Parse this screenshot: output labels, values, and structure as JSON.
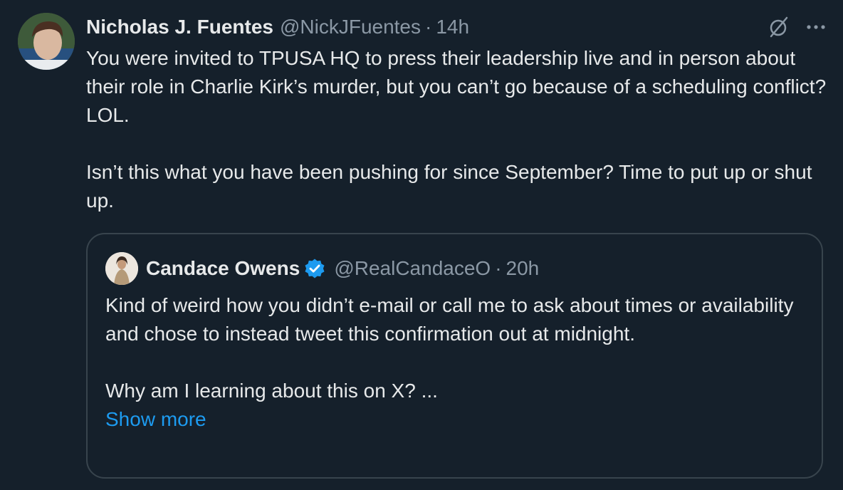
{
  "tweet": {
    "author": {
      "display_name": "Nicholas J. Fuentes",
      "handle": "@NickJFuentes",
      "separator": "·",
      "time": "14h",
      "avatar_icon": "profile-photo"
    },
    "paragraphs": [
      "You were invited to TPUSA HQ to press their leadership live and in person about their role in Charlie Kirk’s murder, but you can’t go because of a scheduling conflict? LOL.",
      "Isn’t this what you have been pushing for since September? Time to put up or shut up."
    ],
    "actions": {
      "grok_icon": "grok-icon",
      "more_icon": "more-options-icon"
    }
  },
  "quote": {
    "author": {
      "display_name": "Candace Owens",
      "verified": true,
      "handle": "@RealCandaceO",
      "separator": "·",
      "time": "20h"
    },
    "paragraphs": [
      "Kind of weird how you didn’t e-mail or call me to ask about times or availability and chose to instead tweet this confirmation out at midnight.",
      "Why am I learning about this on X? ..."
    ],
    "show_more": "Show more"
  },
  "colors": {
    "background": "#15202b",
    "text": "#e7e9ea",
    "secondary": "#8b98a5",
    "accent": "#1d9bf0",
    "border": "#38444d"
  }
}
